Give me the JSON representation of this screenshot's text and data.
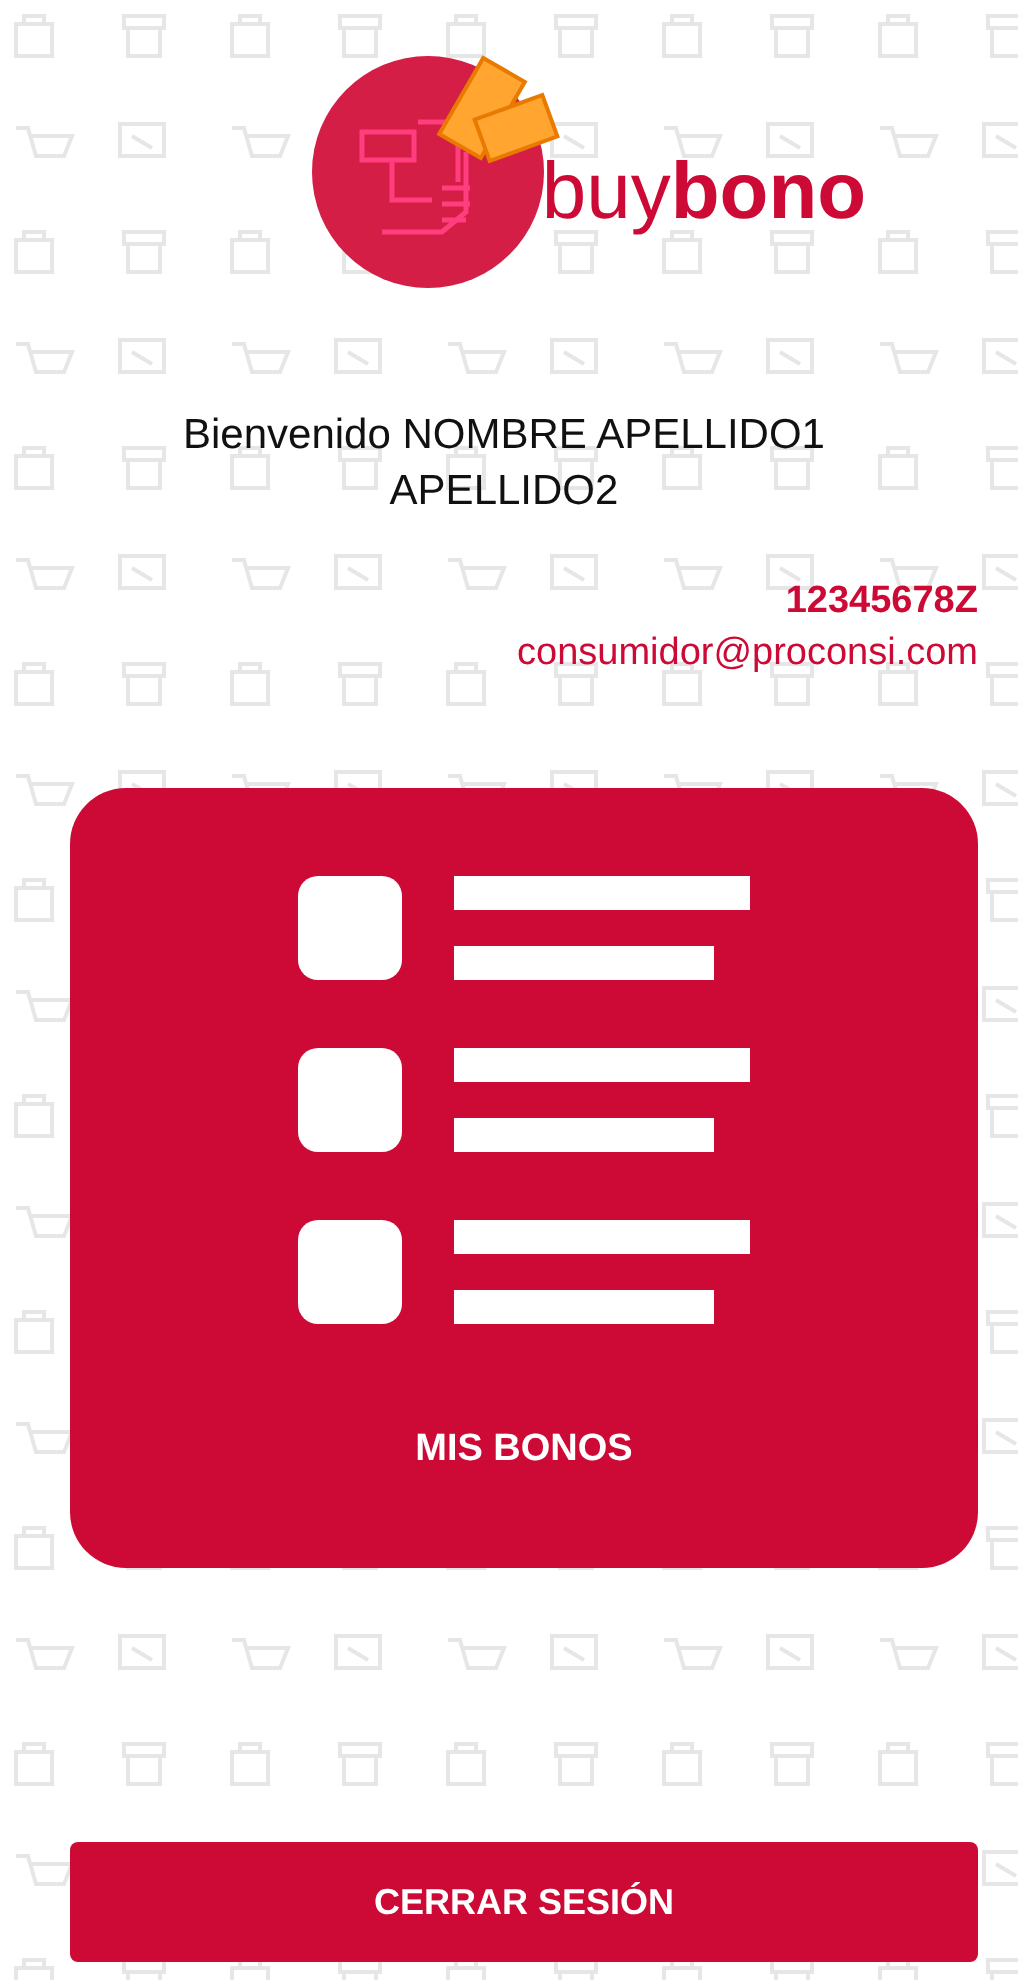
{
  "logo": {
    "wordmark": "buy**bono**"
  },
  "welcome": {
    "text": "Bienvenido NOMBRE APELLIDO1 APELLIDO2"
  },
  "user": {
    "id": "12345678Z",
    "email": "consumidor@proconsi.com"
  },
  "tiles": [
    {
      "label": "MIS BONOS",
      "kind": "list"
    }
  ],
  "logout_button": {
    "label": "CERRAR SESIÓN"
  }
}
